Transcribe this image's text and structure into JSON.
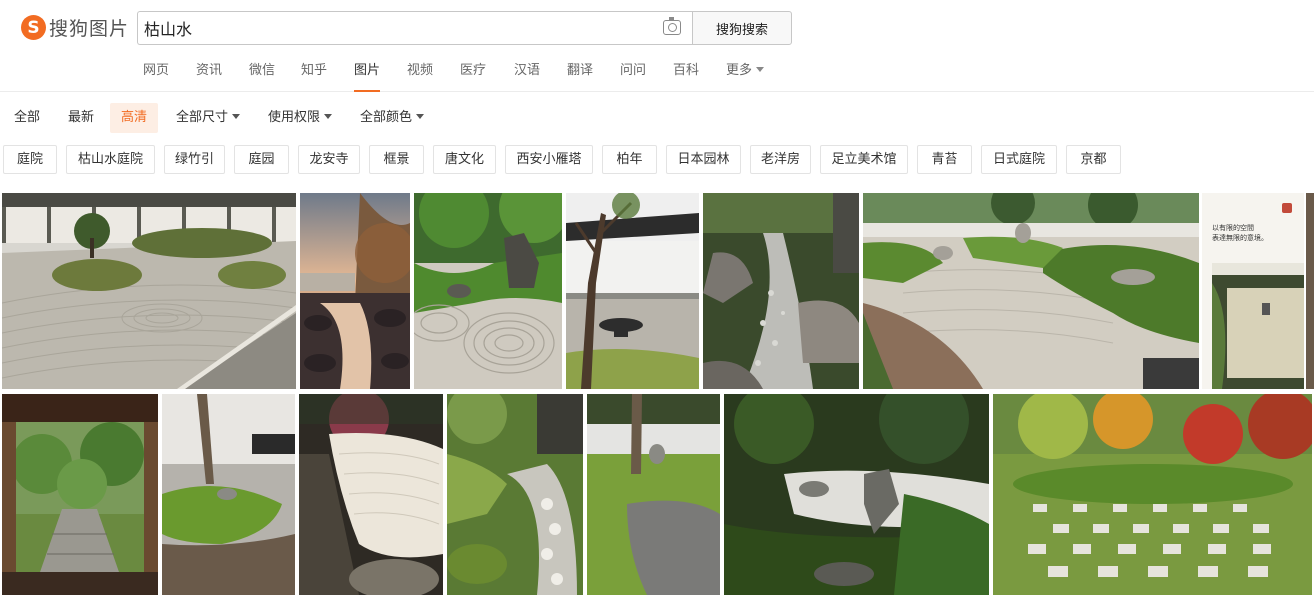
{
  "logo": {
    "mark": "S",
    "text": "搜狗图片"
  },
  "search": {
    "query": "枯山水",
    "button_label": "搜狗搜索",
    "camera_icon": "camera-icon"
  },
  "nav": {
    "items": [
      "网页",
      "资讯",
      "微信",
      "知乎",
      "图片",
      "视频",
      "医疗",
      "汉语",
      "翻译",
      "问问",
      "百科",
      "更多"
    ],
    "active": "图片"
  },
  "filters": {
    "all": "全部",
    "latest": "最新",
    "hd": "高清",
    "size": "全部尺寸",
    "license": "使用权限",
    "color": "全部颜色"
  },
  "tags": [
    "庭院",
    "枯山水庭院",
    "绿竹引",
    "庭园",
    "龙安寺",
    "框景",
    "唐文化",
    "西安小雁塔",
    "柏年",
    "日本园林",
    "老洋房",
    "足立美术馆",
    "青苔",
    "日式庭院",
    "京都"
  ],
  "images": {
    "row1": [
      "zen-garden-raked-gravel-moss-islands",
      "reflecting-pond-sunset",
      "moss-rock-spiral-gravel",
      "courtyard-tree-basin",
      "pebble-stream-boulders",
      "large-moss-rock-garden",
      "text-card-garden"
    ],
    "row2": [
      "gate-view-stone-path",
      "moss-bed-tree-trunk",
      "white-gravel-maple-garden",
      "pebble-path-garden",
      "stepping-stones-moss",
      "forest-garden-rocks",
      "checkerboard-moss-autumn"
    ],
    "overlay_text": [
      "以有限的空間",
      "表達無限的意境。"
    ]
  },
  "colors": {
    "accent": "#f26c22",
    "hd_bg": "#fdeee4"
  }
}
